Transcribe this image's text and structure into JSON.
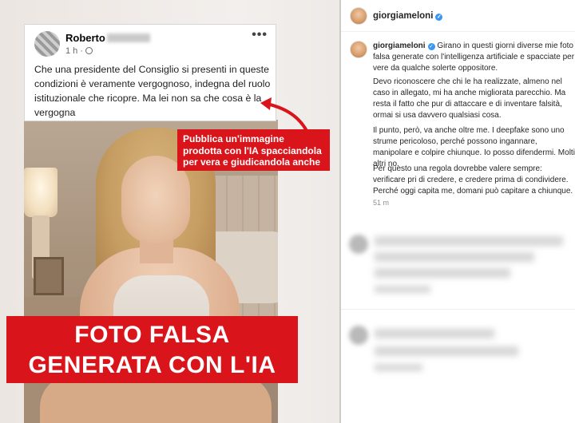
{
  "facebook_post": {
    "author": "Roberto",
    "time": "1 h",
    "text": "Che una presidente del Consiglio  si presenti in queste condizioni è veramente vergognoso, indegna del ruolo istituzionale che ricopre. Ma lei non sa che cosa è la vergogna",
    "more_icon": "more-dots-icon",
    "privacy_icon": "globe-icon"
  },
  "callout": {
    "text": "Pubblica un'immagine prodotta con l'IA spacciandola per vera e giudicandola anche"
  },
  "banner": {
    "line1": "FOTO FALSA",
    "line2": "GENERATA CON L'IA"
  },
  "instagram": {
    "header_user": "giorgiameloni",
    "caption_user": "giorgiameloni",
    "caption_intro": "Girano in questi giorni diverse mie foto falsa generate con l'intelligenza artificiale e spacciate per vere da qualche solerte oppositore.",
    "paragraphs": [
      "Devo riconoscere che chi le ha realizzate, almeno nel caso in allegato, mi ha anche migliorata parecchio. Ma resta il fatto che pur di attaccare e di inventare falsità, ormai si usa davvero qualsiasi cosa.",
      "Il punto, però, va anche oltre me. I deepfake sono uno strume pericoloso, perché possono ingannare, manipolare e colpire chiunque. Io posso difendermi. Molti altri no.",
      "Per questo una regola dovrebbe valere sempre: verificare pri di credere, e credere prima di condividere. Perché oggi capita me, domani può capitare a chiunque."
    ],
    "time": "51 m",
    "accent": "#3897f0"
  },
  "colors": {
    "banner_red": "#d9141b"
  }
}
